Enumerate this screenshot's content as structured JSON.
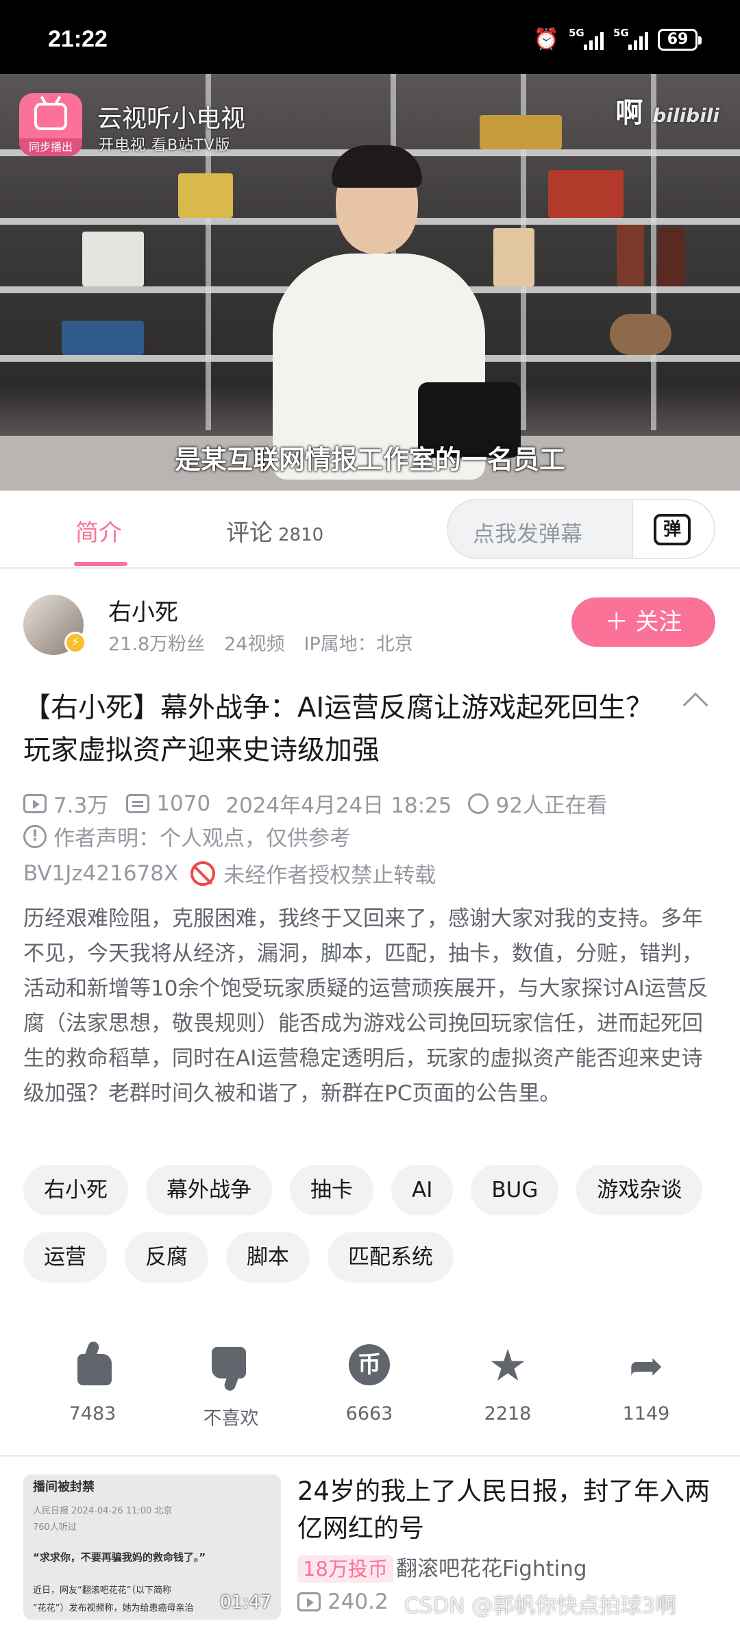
{
  "status_bar": {
    "time": "21:22",
    "battery": "69",
    "net1": "5G",
    "net2": "5G"
  },
  "video": {
    "subtitle": "是某互联网情报工作室的一名员工",
    "overlay_title": "云视听小电视",
    "overlay_sub": "开电视 看B站TV版",
    "sync_label": "同步播出",
    "watermark": "啊"
  },
  "tabs": {
    "intro": "简介",
    "comments": "评论",
    "comments_count": "2810",
    "danmaku_placeholder": "点我发弹幕",
    "danmaku_btn": "弹"
  },
  "uploader": {
    "name": "右小死",
    "followers": "21.8万粉丝",
    "videos": "24视频",
    "ip": "IP属地：北京",
    "follow_label": "＋ 关注"
  },
  "video_info": {
    "title": "【右小死】幕外战争：AI运营反腐让游戏起死回生？玩家虚拟资产迎来史诗级加强",
    "views": "7.3万",
    "danmaku": "1070",
    "date": "2024年4月24日 18:25",
    "watching": "92人正在看",
    "declaration": "作者声明：个人观点，仅供参考",
    "bvid": "BV1Jz421678X",
    "no_repost": "未经作者授权禁止转载",
    "description": "历经艰难险阻，克服困难，我终于又回来了，感谢大家对我的支持。多年不见，今天我将从经济，漏洞，脚本，匹配，抽卡，数值，分赃，错判，活动和新增等10余个饱受玩家质疑的运营顽疾展开，与大家探讨AI运营反腐（法家思想，敬畏规则）能否成为游戏公司挽回玩家信任，进而起死回生的救命稻草，同时在AI运营稳定透明后，玩家的虚拟资产能否迎来史诗级加强？老群时间久被和谐了，新群在PC页面的公告里。"
  },
  "tags": [
    "右小死",
    "幕外战争",
    "抽卡",
    "AI",
    "BUG",
    "游戏杂谈",
    "运营",
    "反腐",
    "脚本",
    "匹配系统"
  ],
  "actions": {
    "like": "7483",
    "dislike": "不喜欢",
    "coin": "6663",
    "favorite": "2218",
    "share": "1149"
  },
  "recommendation": {
    "title": "24岁的我上了人民日报，封了年入两亿网红的号",
    "badge": "18万投币",
    "author": "翻滚吧花花Fighting",
    "views": "240.2",
    "duration": "01:47",
    "watermark": "CSDN @郭帆你快点拍球3啊",
    "thumb_lines": [
      "播间被封禁",
      "人民日报  2024-04-26 11:00  北京",
      "760人听过",
      "“求求你，不要再骗我妈的救命钱了。”",
      "近日，网友“翻滚吧花花”（以下简称",
      "“花花”）发布视频称，她为给患癌母亲治"
    ]
  }
}
